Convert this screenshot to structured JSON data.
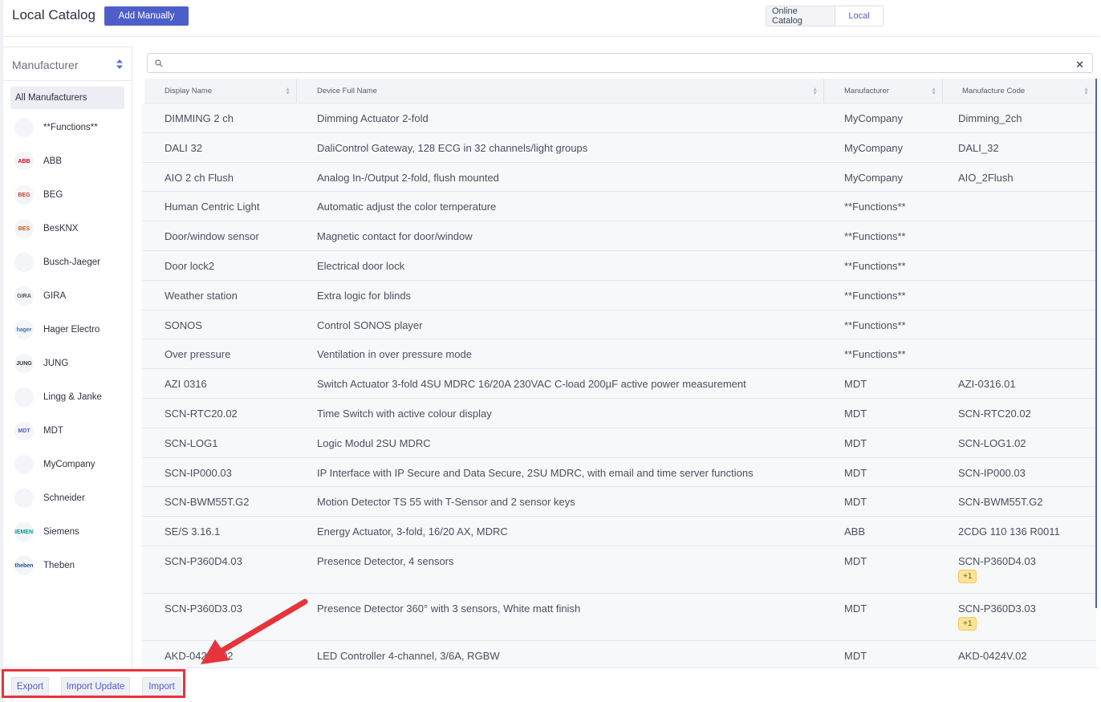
{
  "header": {
    "title": "Local Catalog",
    "add_button": "Add Manually",
    "toggle": {
      "online": "Online Catalog",
      "local": "Local"
    }
  },
  "sidebar": {
    "heading": "Manufacturer",
    "all": "All Manufacturers",
    "items": [
      {
        "name": "**Functions**",
        "logo_text": ""
      },
      {
        "name": "ABB",
        "logo_text": "ABB"
      },
      {
        "name": "BEG",
        "logo_text": "BEG"
      },
      {
        "name": "BesKNX",
        "logo_text": "BES"
      },
      {
        "name": "Busch-Jaeger",
        "logo_text": ""
      },
      {
        "name": "GIRA",
        "logo_text": "GIRA"
      },
      {
        "name": "Hager Electro",
        "logo_text": "hager"
      },
      {
        "name": "JUNG",
        "logo_text": "JUNG"
      },
      {
        "name": "Lingg & Janke",
        "logo_text": ""
      },
      {
        "name": "MDT",
        "logo_text": "MDT"
      },
      {
        "name": "MyCompany",
        "logo_text": ""
      },
      {
        "name": "Schneider",
        "logo_text": ""
      },
      {
        "name": "Siemens",
        "logo_text": "SIEMENS"
      },
      {
        "name": "Theben",
        "logo_text": "theben"
      }
    ]
  },
  "search": {
    "placeholder": ""
  },
  "table": {
    "columns": [
      "Display Name",
      "Device Full Name",
      "Manufacturer",
      "Manufacture Code"
    ],
    "rows": [
      {
        "display": "DIMMING 2 ch",
        "full": "Dimming Actuator 2-fold",
        "manuf": "MyCompany",
        "code": "Dimming_2ch",
        "badge": ""
      },
      {
        "display": "DALI 32",
        "full": "DaliControl Gateway, 128 ECG in 32 channels/light groups",
        "manuf": "MyCompany",
        "code": "DALI_32",
        "badge": ""
      },
      {
        "display": "AIO 2 ch Flush",
        "full": "Analog In-/Output 2-fold, flush mounted",
        "manuf": "MyCompany",
        "code": "AIO_2Flush",
        "badge": ""
      },
      {
        "display": "Human Centric Light",
        "full": "Automatic adjust the color temperature",
        "manuf": "**Functions**",
        "code": "",
        "badge": ""
      },
      {
        "display": "Door/window sensor",
        "full": "Magnetic contact for door/window",
        "manuf": "**Functions**",
        "code": "",
        "badge": ""
      },
      {
        "display": "Door lock2",
        "full": "Electrical door lock",
        "manuf": "**Functions**",
        "code": "",
        "badge": ""
      },
      {
        "display": "Weather station",
        "full": "Extra logic for blinds",
        "manuf": "**Functions**",
        "code": "",
        "badge": ""
      },
      {
        "display": "SONOS",
        "full": "Control SONOS player",
        "manuf": "**Functions**",
        "code": "",
        "badge": ""
      },
      {
        "display": "Over pressure",
        "full": "Ventilation in over pressure mode",
        "manuf": "**Functions**",
        "code": "",
        "badge": ""
      },
      {
        "display": "AZI 0316",
        "full": "Switch Actuator 3-fold 4SU MDRC 16/20A 230VAC C-load 200µF active power measurement",
        "manuf": "MDT",
        "code": "AZI-0316.01",
        "badge": ""
      },
      {
        "display": "SCN-RTC20.02",
        "full": "Time Switch with active colour display",
        "manuf": "MDT",
        "code": "SCN-RTC20.02",
        "badge": ""
      },
      {
        "display": "SCN-LOG1",
        "full": "Logic Modul 2SU MDRC",
        "manuf": "MDT",
        "code": "SCN-LOG1.02",
        "badge": ""
      },
      {
        "display": "SCN-IP000.03",
        "full": "IP Interface with IP Secure and Data Secure, 2SU MDRC, with email and time server functions",
        "manuf": "MDT",
        "code": "SCN-IP000.03",
        "badge": ""
      },
      {
        "display": "SCN-BWM55T.G2",
        "full": "Motion Detector TS 55 with T-Sensor and 2 sensor keys",
        "manuf": "MDT",
        "code": "SCN-BWM55T.G2",
        "badge": ""
      },
      {
        "display": "SE/S 3.16.1",
        "full": "Energy Actuator, 3-fold, 16/20 AX, MDRC",
        "manuf": "ABB",
        "code": "2CDG 110 136 R0011",
        "badge": ""
      },
      {
        "display": "SCN-P360D4.03",
        "full": "Presence Detector, 4 sensors",
        "manuf": "MDT",
        "code": "SCN-P360D4.03",
        "badge": "+1"
      },
      {
        "display": "SCN-P360D3.03",
        "full": "Presence Detector 360° with 3 sensors, White matt finish",
        "manuf": "MDT",
        "code": "SCN-P360D3.03",
        "badge": "+1"
      },
      {
        "display": "AKD-0424V.02",
        "full": "LED Controller 4-channel, 3/6A, RGBW",
        "manuf": "MDT",
        "code": "AKD-0424V.02",
        "badge": ""
      }
    ]
  },
  "footer": {
    "export": "Export",
    "import_update": "Import Update",
    "import": "Import"
  },
  "colors": {
    "accent": "#4e5ec9",
    "highlight": "#e5343a",
    "badge": "#fbe39a"
  }
}
